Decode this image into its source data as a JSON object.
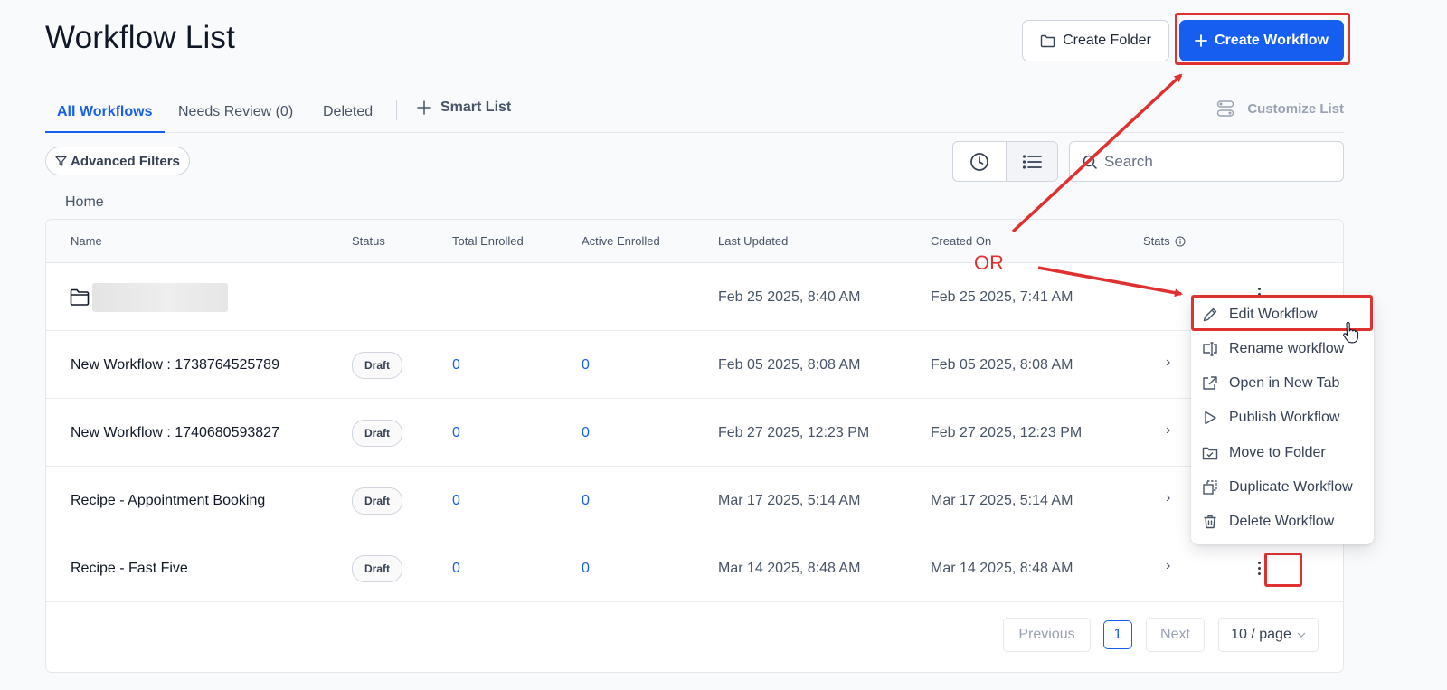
{
  "header": {
    "title": "Workflow List",
    "create_folder_label": "Create Folder",
    "create_workflow_label": "Create Workflow"
  },
  "tabs": [
    {
      "label": "All Workflows",
      "active": true
    },
    {
      "label": "Needs Review (0)",
      "active": false
    },
    {
      "label": "Deleted",
      "active": false
    }
  ],
  "smart_list_label": "Smart List",
  "customize_list_label": "Customize List",
  "filters": {
    "advanced_label": "Advanced Filters"
  },
  "search": {
    "placeholder": "Search",
    "value": ""
  },
  "breadcrumb": "Home",
  "table": {
    "columns": [
      "Name",
      "Status",
      "Total Enrolled",
      "Active Enrolled",
      "Last Updated",
      "Created On",
      "Stats"
    ],
    "rows": [
      {
        "type": "folder",
        "name": "",
        "status": "",
        "total": "",
        "active": "",
        "updated": "Feb 25 2025, 8:40 AM",
        "created": "Feb 25 2025, 7:41 AM"
      },
      {
        "type": "workflow",
        "name": "New Workflow : 1738764525789",
        "status": "Draft",
        "total": "0",
        "active": "0",
        "updated": "Feb 05 2025, 8:08 AM",
        "created": "Feb 05 2025, 8:08 AM"
      },
      {
        "type": "workflow",
        "name": "New Workflow : 1740680593827",
        "status": "Draft",
        "total": "0",
        "active": "0",
        "updated": "Feb 27 2025, 12:23 PM",
        "created": "Feb 27 2025, 12:23 PM"
      },
      {
        "type": "workflow",
        "name": "Recipe - Appointment Booking",
        "status": "Draft",
        "total": "0",
        "active": "0",
        "updated": "Mar 17 2025, 5:14 AM",
        "created": "Mar 17 2025, 5:14 AM"
      },
      {
        "type": "workflow",
        "name": "Recipe - Fast Five",
        "status": "Draft",
        "total": "0",
        "active": "0",
        "updated": "Mar 14 2025, 8:48 AM",
        "created": "Mar 14 2025, 8:48 AM"
      }
    ]
  },
  "pagination": {
    "previous": "Previous",
    "current": "1",
    "next": "Next",
    "page_size": "10 / page"
  },
  "context_menu": {
    "items": [
      {
        "label": "Edit Workflow",
        "icon": "pencil-icon"
      },
      {
        "label": "Rename workflow",
        "icon": "rename-icon"
      },
      {
        "label": "Open in New Tab",
        "icon": "external-link-icon"
      },
      {
        "label": "Publish Workflow",
        "icon": "play-icon"
      },
      {
        "label": "Move to Folder",
        "icon": "folder-move-icon"
      },
      {
        "label": "Duplicate Workflow",
        "icon": "duplicate-icon"
      },
      {
        "label": "Delete Workflow",
        "icon": "trash-icon"
      }
    ]
  },
  "annotation": {
    "or_label": "OR",
    "color": "#e03131"
  },
  "colors": {
    "primary": "#155eef",
    "annotation": "#e03131"
  }
}
